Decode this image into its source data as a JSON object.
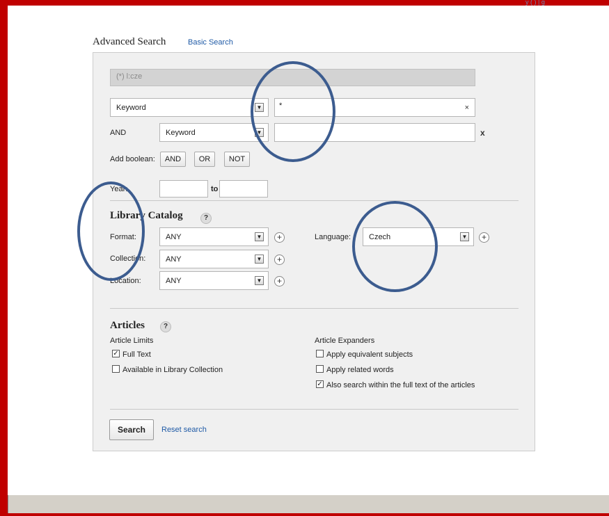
{
  "header": {
    "title": "Advanced Search",
    "basic_search_link": "Basic Search",
    "top_links": "y (   ) |   g"
  },
  "query_display": "(*) l:cze",
  "rows": [
    {
      "field": "Keyword",
      "value": "*",
      "clear": "×"
    },
    {
      "operator": "AND",
      "field": "Keyword",
      "value": "",
      "remove": "x"
    }
  ],
  "boolean": {
    "label": "Add boolean:",
    "buttons": [
      "AND",
      "OR",
      "NOT"
    ]
  },
  "year": {
    "label": "Year:",
    "from": "",
    "to_label": "to",
    "to": ""
  },
  "library_catalog": {
    "title": "Library Catalog",
    "help": "?",
    "format": {
      "label": "Format:",
      "value": "ANY"
    },
    "collection": {
      "label": "Collection:",
      "value": "ANY"
    },
    "location": {
      "label": "Location:",
      "value": "ANY"
    },
    "language": {
      "label": "Language:",
      "value": "Czech"
    }
  },
  "articles": {
    "title": "Articles",
    "help": "?",
    "limits_label": "Article Limits",
    "limits": [
      {
        "label": "Full Text",
        "checked": true
      },
      {
        "label": "Available in Library Collection",
        "checked": false
      }
    ],
    "expanders_label": "Article Expanders",
    "expanders": [
      {
        "label": "Apply equivalent subjects",
        "checked": false
      },
      {
        "label": "Apply related words",
        "checked": false
      },
      {
        "label": "Also search within the full text of the articles",
        "checked": true
      }
    ]
  },
  "actions": {
    "search": "Search",
    "reset": "Reset search"
  },
  "glyphs": {
    "dropdown": "▼",
    "plus": "+",
    "check": "✓"
  },
  "colors": {
    "frame": "#c00000",
    "annotation": "#3c5c8f",
    "link": "#1f5aa6"
  }
}
